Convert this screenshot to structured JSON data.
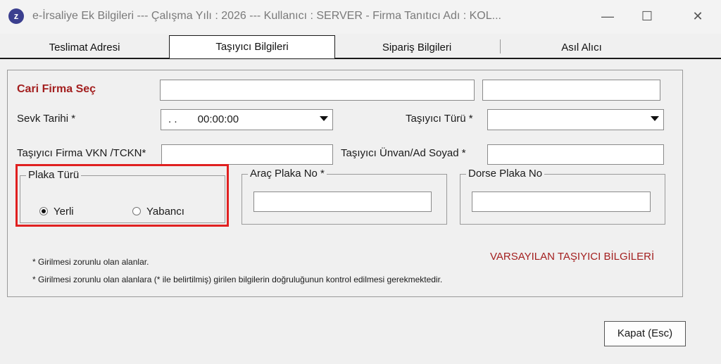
{
  "window": {
    "title": "e-İrsaliye Ek Bilgileri  ---  Çalışma Yılı : 2026  ---  Kullanıcı : SERVER - Firma Tanıtıcı Adı : KOL...",
    "app_icon_letter": "z",
    "minimize_glyph": "—",
    "maximize_glyph": "☐",
    "close_glyph": "✕"
  },
  "tabs": [
    {
      "label": "Teslimat Adresi",
      "active": false
    },
    {
      "label": "Taşıyıcı Bilgileri",
      "active": true
    },
    {
      "label": "Sipariş Bilgileri",
      "active": false
    },
    {
      "label": "Asıl Alıcı",
      "active": false
    }
  ],
  "form": {
    "cari_firma_label": "Cari Firma Seç",
    "sevk_tarihi_label": "Sevk Tarihi *",
    "sevk_tarihi_value": ". .       00:00:00",
    "tasiyici_turu_label": "Taşıyıcı Türü *",
    "vkn_label": "Taşıyıcı Firma VKN /TCKN*",
    "unvan_label": "Taşıyıcı Ünvan/Ad Soyad *",
    "plaka_turu_title": "Plaka Türü",
    "yerli_label": "Yerli",
    "yabanci_label": "Yabancı",
    "arac_plaka_title": "Araç Plaka No *",
    "dorse_plaka_title": "Dorse Plaka No",
    "default_carrier_label": "VARSAYILAN TAŞIYICI BİLGİLERİ",
    "note1": "* Girilmesi zorunlu olan alanlar.",
    "note2": "* Girilmesi zorunlu olan alanlara (* ile belirtilmiş) girilen bilgilerin doğruluğunun kontrol edilmesi gerekmektedir."
  },
  "buttons": {
    "close_label": "Kapat (Esc)"
  },
  "colors": {
    "required_label": "#a31f1f",
    "highlight_box": "#e02020"
  }
}
